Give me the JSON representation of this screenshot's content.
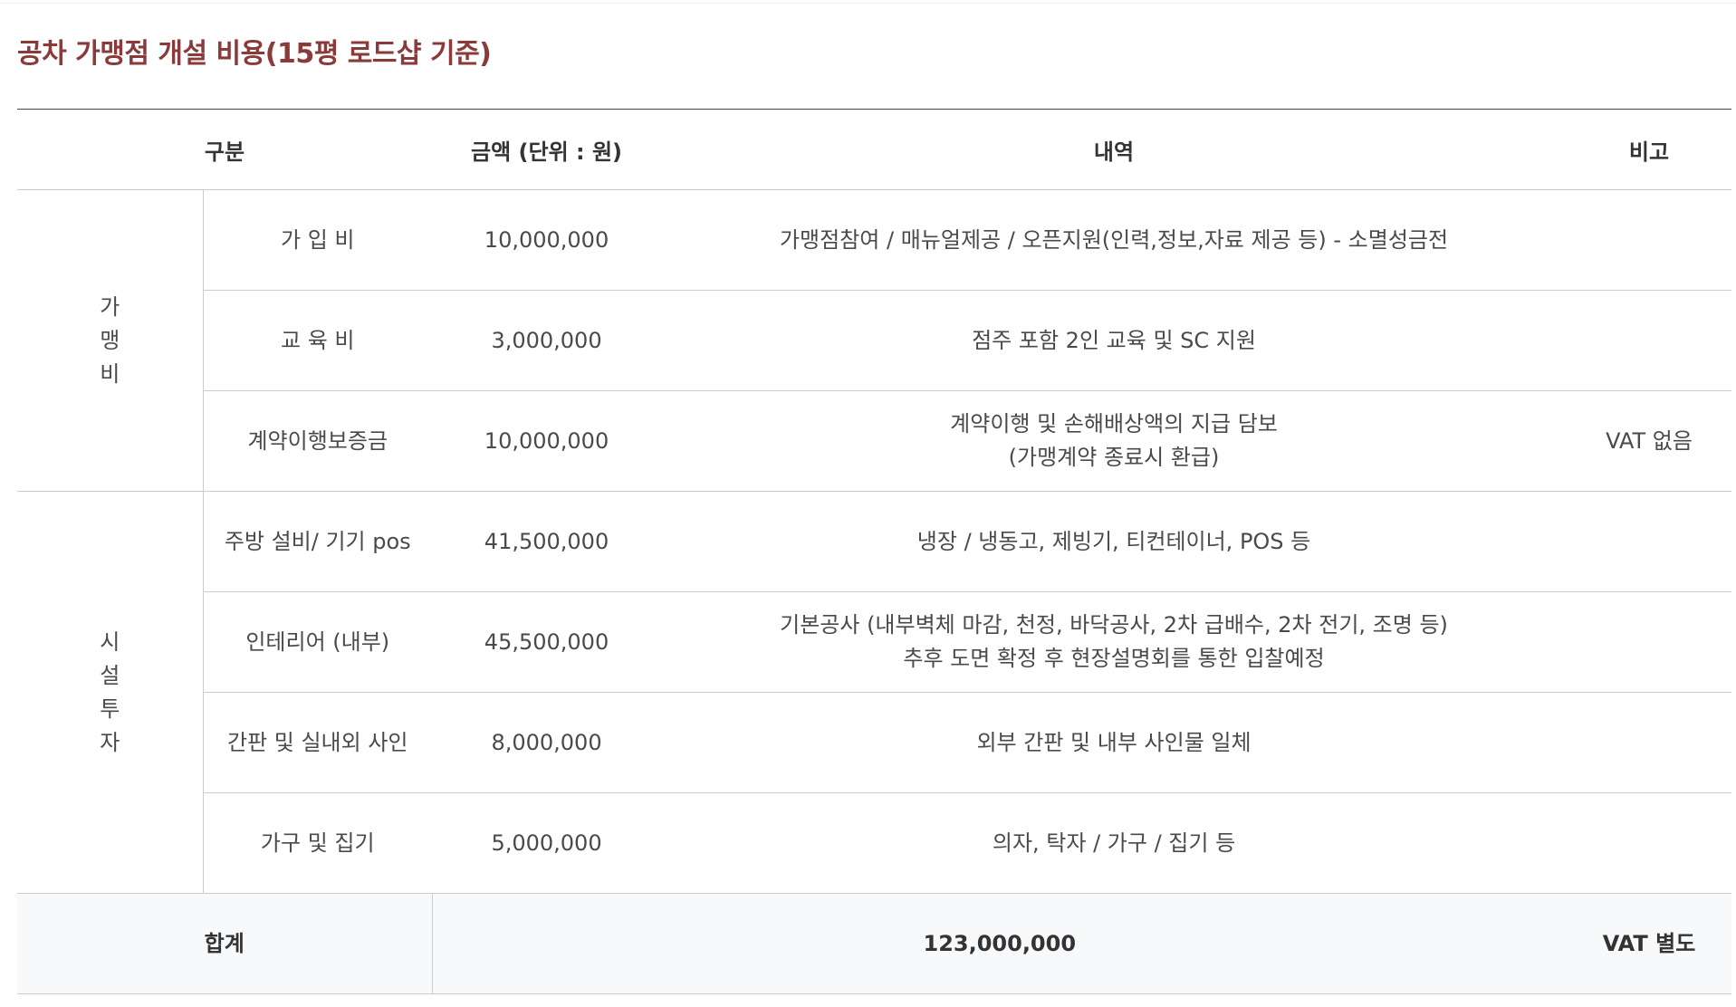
{
  "title": "공차 가맹점 개설 비용(15평 로드샵 기준)",
  "table": {
    "headers": {
      "category": "구분",
      "amount": "금액 (단위 : 원)",
      "details": "내역",
      "remarks": "비고"
    },
    "groups": {
      "franchise": "가맹비",
      "facility": "시설투자"
    },
    "rows": [
      {
        "item": "가 입 비",
        "amount": "10,000,000",
        "details_line1": "가맹점참여 / 매뉴얼제공 / 오픈지원(인력,정보,자료 제공 등) - 소멸성금전",
        "details_line2": "",
        "remarks": ""
      },
      {
        "item": "교 육 비",
        "amount": "3,000,000",
        "details_line1": "점주 포함 2인 교육 및 SC 지원",
        "details_line2": "",
        "remarks": ""
      },
      {
        "item": "계약이행보증금",
        "amount": "10,000,000",
        "details_line1": "계약이행 및 손해배상액의 지급 담보",
        "details_line2": "(가맹계약 종료시 환급)",
        "remarks": "VAT 없음"
      },
      {
        "item": "주방 설비/ 기기 pos",
        "amount": "41,500,000",
        "details_line1": "냉장 / 냉동고, 제빙기, 티컨테이너, POS 등",
        "details_line2": "",
        "remarks": ""
      },
      {
        "item": "인테리어 (내부)",
        "amount": "45,500,000",
        "details_line1": "기본공사 (내부벽체 마감, 천정, 바닥공사, 2차 급배수, 2차 전기, 조명 등)",
        "details_line2": "추후 도면 확정 후 현장설명회를 통한 입찰예정",
        "remarks": ""
      },
      {
        "item": "간판 및 실내외 사인",
        "amount": "8,000,000",
        "details_line1": "외부 간판 및 내부 사인물 일체",
        "details_line2": "",
        "remarks": ""
      },
      {
        "item": "가구 및 집기",
        "amount": "5,000,000",
        "details_line1": "의자, 탁자 / 가구 / 집기 등",
        "details_line2": "",
        "remarks": ""
      }
    ],
    "total": {
      "label": "합계",
      "amount": "123,000,000",
      "remarks": "VAT 별도"
    }
  }
}
